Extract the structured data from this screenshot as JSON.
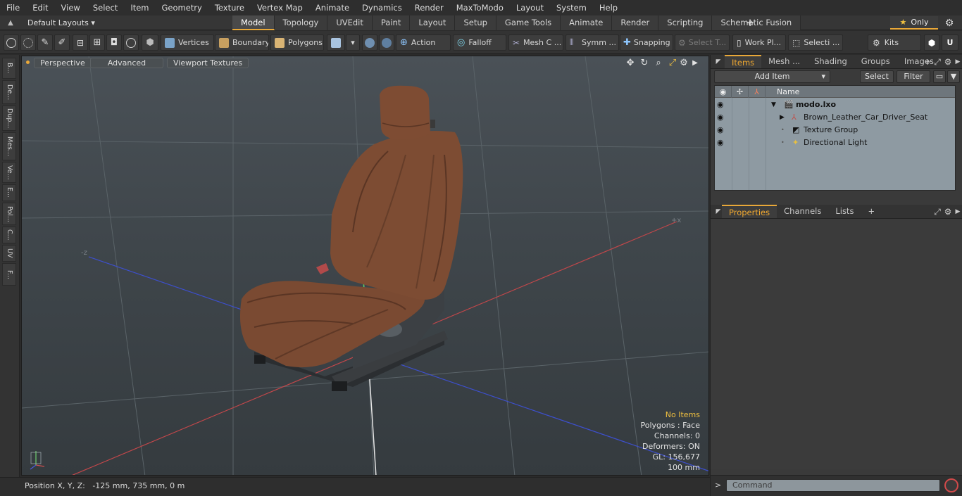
{
  "menu": [
    "File",
    "Edit",
    "View",
    "Select",
    "Item",
    "Geometry",
    "Texture",
    "Vertex Map",
    "Animate",
    "Dynamics",
    "Render",
    "MaxToModo",
    "Layout",
    "System",
    "Help"
  ],
  "layout_selector": "Default Layouts",
  "main_tabs": [
    {
      "label": "Model",
      "active": true
    },
    {
      "label": "Topology"
    },
    {
      "label": "UVEdit"
    },
    {
      "label": "Paint"
    },
    {
      "label": "Layout"
    },
    {
      "label": "Setup"
    },
    {
      "label": "Game Tools"
    },
    {
      "label": "Animate"
    },
    {
      "label": "Render"
    },
    {
      "label": "Scripting"
    },
    {
      "label": "Schematic Fusion"
    }
  ],
  "only_label": "Only",
  "toolbar": {
    "vertices": "Vertices",
    "boundary": "Boundary",
    "polygons": "Polygons",
    "action": "Action",
    "falloff": "Falloff",
    "mesh": "Mesh C ...",
    "symmetry": "Symm ...",
    "snapping": "Snapping",
    "select_t": "Select T...",
    "work_plane": "Work Pl...",
    "selection": "Selecti ...",
    "kits": "Kits"
  },
  "left_tabs": [
    "B...",
    "De...",
    "Dup...",
    "Mes...",
    "Ve...",
    "E...",
    "Pol...",
    "C...",
    "UV",
    "F..."
  ],
  "viewport": {
    "buttons": [
      "Perspective",
      "Advanced",
      "Viewport Textures"
    ],
    "info": {
      "no_items": "No Items",
      "polygons": "Polygons : Face",
      "channels": "Channels: 0",
      "deformers": "Deformers: ON",
      "gl": "GL: 156,677",
      "scale": "100 mm"
    }
  },
  "status": {
    "position_label": "Position X, Y, Z:",
    "position_value": "-125 mm, 735 mm, 0 m"
  },
  "right_panel": {
    "top_tabs": [
      {
        "label": "Items",
        "active": true
      },
      {
        "label": "Mesh ..."
      },
      {
        "label": "Shading"
      },
      {
        "label": "Groups"
      },
      {
        "label": "Images"
      }
    ],
    "add_item": "Add Item",
    "select": "Select",
    "filter": "Filter",
    "name_header": "Name",
    "items": [
      {
        "name": "modo.lxo",
        "icon": "scene-icon"
      },
      {
        "name": "Brown_Leather_Car_Driver_Seat",
        "icon": "mesh-icon"
      },
      {
        "name": "Texture Group",
        "icon": "texture-group-icon"
      },
      {
        "name": "Directional Light",
        "icon": "light-icon"
      }
    ],
    "bottom_tabs": [
      {
        "label": "Properties",
        "active": true
      },
      {
        "label": "Channels"
      },
      {
        "label": "Lists"
      }
    ],
    "command_placeholder": "Command"
  }
}
